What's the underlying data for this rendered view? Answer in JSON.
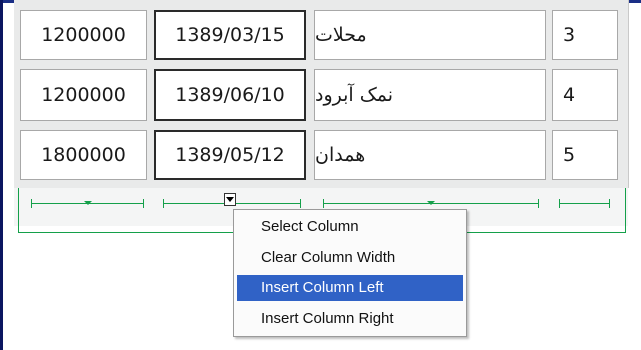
{
  "table": {
    "rows": [
      {
        "amount": "1200000",
        "date": "1389/03/15",
        "city": "محلات",
        "index": "3"
      },
      {
        "amount": "1200000",
        "date": "1389/06/10",
        "city": "نمک آبرود",
        "index": "4"
      },
      {
        "amount": "1800000",
        "date": "1389/05/12",
        "city": "همدان",
        "index": "5"
      }
    ]
  },
  "context_menu": {
    "items": [
      {
        "label": "Select Column"
      },
      {
        "label": "Clear Column Width"
      },
      {
        "label": "Insert Column Left",
        "highlighted": true
      },
      {
        "label": "Insert Column Right"
      }
    ]
  },
  "colors": {
    "ruler": "#14a04a",
    "menu_highlight": "#3062c6",
    "window_border": "#0a1560"
  },
  "icons": {
    "column_dropdown": "chevron-down-icon"
  }
}
